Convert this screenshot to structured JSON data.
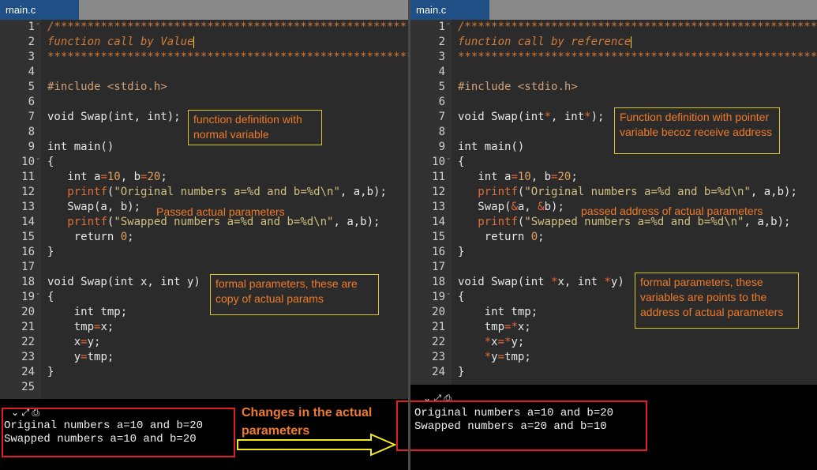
{
  "left": {
    "tab": "main.c",
    "lines": [
      {
        "n": "1",
        "fold": "-",
        "html": "<span class='cm'>/*****************************************************</span>"
      },
      {
        "n": "2",
        "fold": "",
        "html": "<span class='cm'>function call by Value</span><span class='caret'></span>"
      },
      {
        "n": "3",
        "fold": "",
        "html": "<span class='cm'>*******************************************************</span>"
      },
      {
        "n": "4",
        "fold": "",
        "html": ""
      },
      {
        "n": "5",
        "fold": "",
        "html": "<span class='pp'>#include</span> <span class='inc'>&lt;stdio.h&gt;</span>"
      },
      {
        "n": "6",
        "fold": "",
        "html": ""
      },
      {
        "n": "7",
        "fold": "",
        "html": "void Swap(int, int);"
      },
      {
        "n": "8",
        "fold": "",
        "html": ""
      },
      {
        "n": "9",
        "fold": "",
        "html": "int main()"
      },
      {
        "n": "10",
        "fold": "-",
        "html": "{"
      },
      {
        "n": "11",
        "fold": "",
        "html": "   int a<span class='op'>=</span><span class='num'>10</span>, b<span class='op'>=</span><span class='num'>20</span>;"
      },
      {
        "n": "12",
        "fold": "",
        "html": "   <span class='pr'>printf</span>(<span class='str'>\"Original numbers a=%d and b=%d\\n\"</span>, a,b);"
      },
      {
        "n": "13",
        "fold": "",
        "html": "   Swap(a, b);"
      },
      {
        "n": "14",
        "fold": "",
        "html": "   <span class='pr'>printf</span>(<span class='str'>\"Swapped numbers a=%d and b=%d\\n\"</span>, a,b);"
      },
      {
        "n": "15",
        "fold": "",
        "html": "    return <span class='num'>0</span>;"
      },
      {
        "n": "16",
        "fold": "",
        "html": "}"
      },
      {
        "n": "17",
        "fold": "",
        "html": ""
      },
      {
        "n": "18",
        "fold": "",
        "html": "void Swap(int x, int y)"
      },
      {
        "n": "19",
        "fold": "-",
        "html": "{"
      },
      {
        "n": "20",
        "fold": "",
        "html": "    int tmp;"
      },
      {
        "n": "21",
        "fold": "",
        "html": "    tmp<span class='op'>=</span>x;"
      },
      {
        "n": "22",
        "fold": "",
        "html": "    x<span class='op'>=</span>y;"
      },
      {
        "n": "23",
        "fold": "",
        "html": "    y<span class='op'>=</span>tmp;"
      },
      {
        "n": "24",
        "fold": "",
        "html": "}"
      },
      {
        "n": "25",
        "fold": "",
        "html": ""
      }
    ],
    "note_definition": "function definition with normal variable",
    "note_passed": "Passed actual parameters",
    "note_formal": "formal parameters, these are copy of actual params",
    "output": [
      "Original numbers a=10 and b=20",
      "Swapped numbers a=10 and b=20"
    ]
  },
  "right": {
    "tab": "main.c",
    "lines": [
      {
        "n": "1",
        "fold": "-",
        "html": "<span class='cm'>/*****************************************************</span>"
      },
      {
        "n": "2",
        "fold": "",
        "html": "<span class='cm'>function call by reference</span><span class='caret'></span>"
      },
      {
        "n": "3",
        "fold": "",
        "html": "<span class='cm'>*******************************************************</span>"
      },
      {
        "n": "4",
        "fold": "",
        "html": ""
      },
      {
        "n": "5",
        "fold": "",
        "html": "<span class='pp'>#include</span> <span class='inc'>&lt;stdio.h&gt;</span>"
      },
      {
        "n": "6",
        "fold": "",
        "html": ""
      },
      {
        "n": "7",
        "fold": "",
        "html": "void Swap(int<span class='op'>*</span>, int<span class='op'>*</span>);"
      },
      {
        "n": "8",
        "fold": "",
        "html": ""
      },
      {
        "n": "9",
        "fold": "",
        "html": "int main()"
      },
      {
        "n": "10",
        "fold": "-",
        "html": "{"
      },
      {
        "n": "11",
        "fold": "",
        "html": "   int a<span class='op'>=</span><span class='num'>10</span>, b<span class='op'>=</span><span class='num'>20</span>;"
      },
      {
        "n": "12",
        "fold": "",
        "html": "   <span class='pr'>printf</span>(<span class='str'>\"Original numbers a=%d and b=%d\\n\"</span>, a,b);"
      },
      {
        "n": "13",
        "fold": "",
        "html": "   Swap(<span class='op'>&amp;</span>a, <span class='op'>&amp;</span>b);"
      },
      {
        "n": "14",
        "fold": "",
        "html": "   <span class='pr'>printf</span>(<span class='str'>\"Swapped numbers a=%d and b=%d\\n\"</span>, a,b);"
      },
      {
        "n": "15",
        "fold": "",
        "html": "    return <span class='num'>0</span>;"
      },
      {
        "n": "16",
        "fold": "",
        "html": "}"
      },
      {
        "n": "17",
        "fold": "",
        "html": ""
      },
      {
        "n": "18",
        "fold": "",
        "html": "void Swap(int <span class='op'>*</span>x, int <span class='op'>*</span>y)"
      },
      {
        "n": "19",
        "fold": "-",
        "html": "{"
      },
      {
        "n": "20",
        "fold": "",
        "html": "    int tmp;"
      },
      {
        "n": "21",
        "fold": "",
        "html": "    tmp<span class='op'>=*</span>x;"
      },
      {
        "n": "22",
        "fold": "",
        "html": "    <span class='op'>*</span>x<span class='op'>=*</span>y;"
      },
      {
        "n": "23",
        "fold": "",
        "html": "    <span class='op'>*</span>y<span class='op'>=</span>tmp;"
      },
      {
        "n": "24",
        "fold": "",
        "html": "}"
      }
    ],
    "note_definition": "Function definition with pointer variable becoz receive address",
    "note_passed": "passed address of actual parameters",
    "note_formal": "formal parameters, these variables are points to the address of actual parameters",
    "output": [
      "Original numbers a=10 and b=20",
      "Swapped numbers a=20 and b=10"
    ]
  },
  "changes_label": "Changes in the actual parameters",
  "colors": {
    "tab": "#1f4f85",
    "note_border": "#d9c62a",
    "note_text": "#f07a2a",
    "red_box": "#e02020",
    "arrow": "#f2ea1e"
  }
}
